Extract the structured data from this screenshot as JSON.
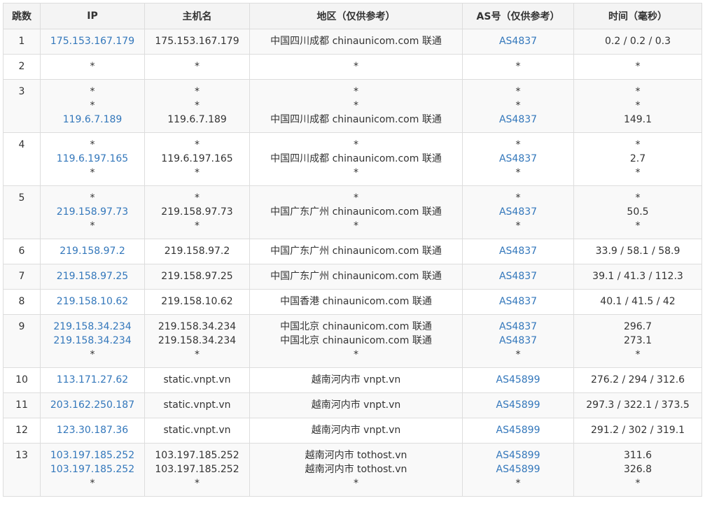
{
  "headers": {
    "hop": "跳数",
    "ip": "IP",
    "host": "主机名",
    "region": "地区（仅供参考）",
    "as": "AS号（仅供参考）",
    "time": "时间（毫秒）"
  },
  "colors": {
    "link": "#3377bb",
    "border": "#dddddd",
    "header_bg": "#f4f4f4",
    "stripe_bg": "#f9f9f9"
  },
  "rows": [
    {
      "hop": "1",
      "ip": [
        "175.153.167.179"
      ],
      "host": [
        "175.153.167.179"
      ],
      "region": [
        "中国四川成都 chinaunicom.com 联通"
      ],
      "as": [
        "AS4837"
      ],
      "time": [
        "0.2 / 0.2 / 0.3"
      ]
    },
    {
      "hop": "2",
      "ip": [
        "*"
      ],
      "host": [
        "*"
      ],
      "region": [
        "*"
      ],
      "as": [
        "*"
      ],
      "time": [
        "*"
      ]
    },
    {
      "hop": "3",
      "ip": [
        "*",
        "*",
        "119.6.7.189"
      ],
      "host": [
        "*",
        "*",
        "119.6.7.189"
      ],
      "region": [
        "*",
        "*",
        "中国四川成都 chinaunicom.com 联通"
      ],
      "as": [
        "*",
        "*",
        "AS4837"
      ],
      "time": [
        "*",
        "*",
        "149.1"
      ]
    },
    {
      "hop": "4",
      "ip": [
        "*",
        "119.6.197.165",
        "*"
      ],
      "host": [
        "*",
        "119.6.197.165",
        "*"
      ],
      "region": [
        "*",
        "中国四川成都 chinaunicom.com 联通",
        "*"
      ],
      "as": [
        "*",
        "AS4837",
        "*"
      ],
      "time": [
        "*",
        "2.7",
        "*"
      ]
    },
    {
      "hop": "5",
      "ip": [
        "*",
        "219.158.97.73",
        "*"
      ],
      "host": [
        "*",
        "219.158.97.73",
        "*"
      ],
      "region": [
        "*",
        "中国广东广州 chinaunicom.com 联通",
        "*"
      ],
      "as": [
        "*",
        "AS4837",
        "*"
      ],
      "time": [
        "*",
        "50.5",
        "*"
      ]
    },
    {
      "hop": "6",
      "ip": [
        "219.158.97.2"
      ],
      "host": [
        "219.158.97.2"
      ],
      "region": [
        "中国广东广州 chinaunicom.com 联通"
      ],
      "as": [
        "AS4837"
      ],
      "time": [
        "33.9 / 58.1 / 58.9"
      ]
    },
    {
      "hop": "7",
      "ip": [
        "219.158.97.25"
      ],
      "host": [
        "219.158.97.25"
      ],
      "region": [
        "中国广东广州 chinaunicom.com 联通"
      ],
      "as": [
        "AS4837"
      ],
      "time": [
        "39.1 / 41.3 / 112.3"
      ]
    },
    {
      "hop": "8",
      "ip": [
        "219.158.10.62"
      ],
      "host": [
        "219.158.10.62"
      ],
      "region": [
        "中国香港 chinaunicom.com 联通"
      ],
      "as": [
        "AS4837"
      ],
      "time": [
        "40.1 / 41.5 / 42"
      ]
    },
    {
      "hop": "9",
      "ip": [
        "219.158.34.234",
        "219.158.34.234",
        "*"
      ],
      "host": [
        "219.158.34.234",
        "219.158.34.234",
        "*"
      ],
      "region": [
        "中国北京 chinaunicom.com 联通",
        "中国北京 chinaunicom.com 联通",
        "*"
      ],
      "as": [
        "AS4837",
        "AS4837",
        "*"
      ],
      "time": [
        "296.7",
        "273.1",
        "*"
      ]
    },
    {
      "hop": "10",
      "ip": [
        "113.171.27.62"
      ],
      "host": [
        "static.vnpt.vn"
      ],
      "region": [
        "越南河内市 vnpt.vn"
      ],
      "as": [
        "AS45899"
      ],
      "time": [
        "276.2 / 294 / 312.6"
      ]
    },
    {
      "hop": "11",
      "ip": [
        "203.162.250.187"
      ],
      "host": [
        "static.vnpt.vn"
      ],
      "region": [
        "越南河内市 vnpt.vn"
      ],
      "as": [
        "AS45899"
      ],
      "time": [
        "297.3 / 322.1 / 373.5"
      ]
    },
    {
      "hop": "12",
      "ip": [
        "123.30.187.36"
      ],
      "host": [
        "static.vnpt.vn"
      ],
      "region": [
        "越南河内市 vnpt.vn"
      ],
      "as": [
        "AS45899"
      ],
      "time": [
        "291.2 / 302 / 319.1"
      ]
    },
    {
      "hop": "13",
      "ip": [
        "103.197.185.252",
        "103.197.185.252",
        "*"
      ],
      "host": [
        "103.197.185.252",
        "103.197.185.252",
        "*"
      ],
      "region": [
        "越南河内市 tothost.vn",
        "越南河内市 tothost.vn",
        "*"
      ],
      "as": [
        "AS45899",
        "AS45899",
        "*"
      ],
      "time": [
        "311.6",
        "326.8",
        "*"
      ]
    }
  ]
}
